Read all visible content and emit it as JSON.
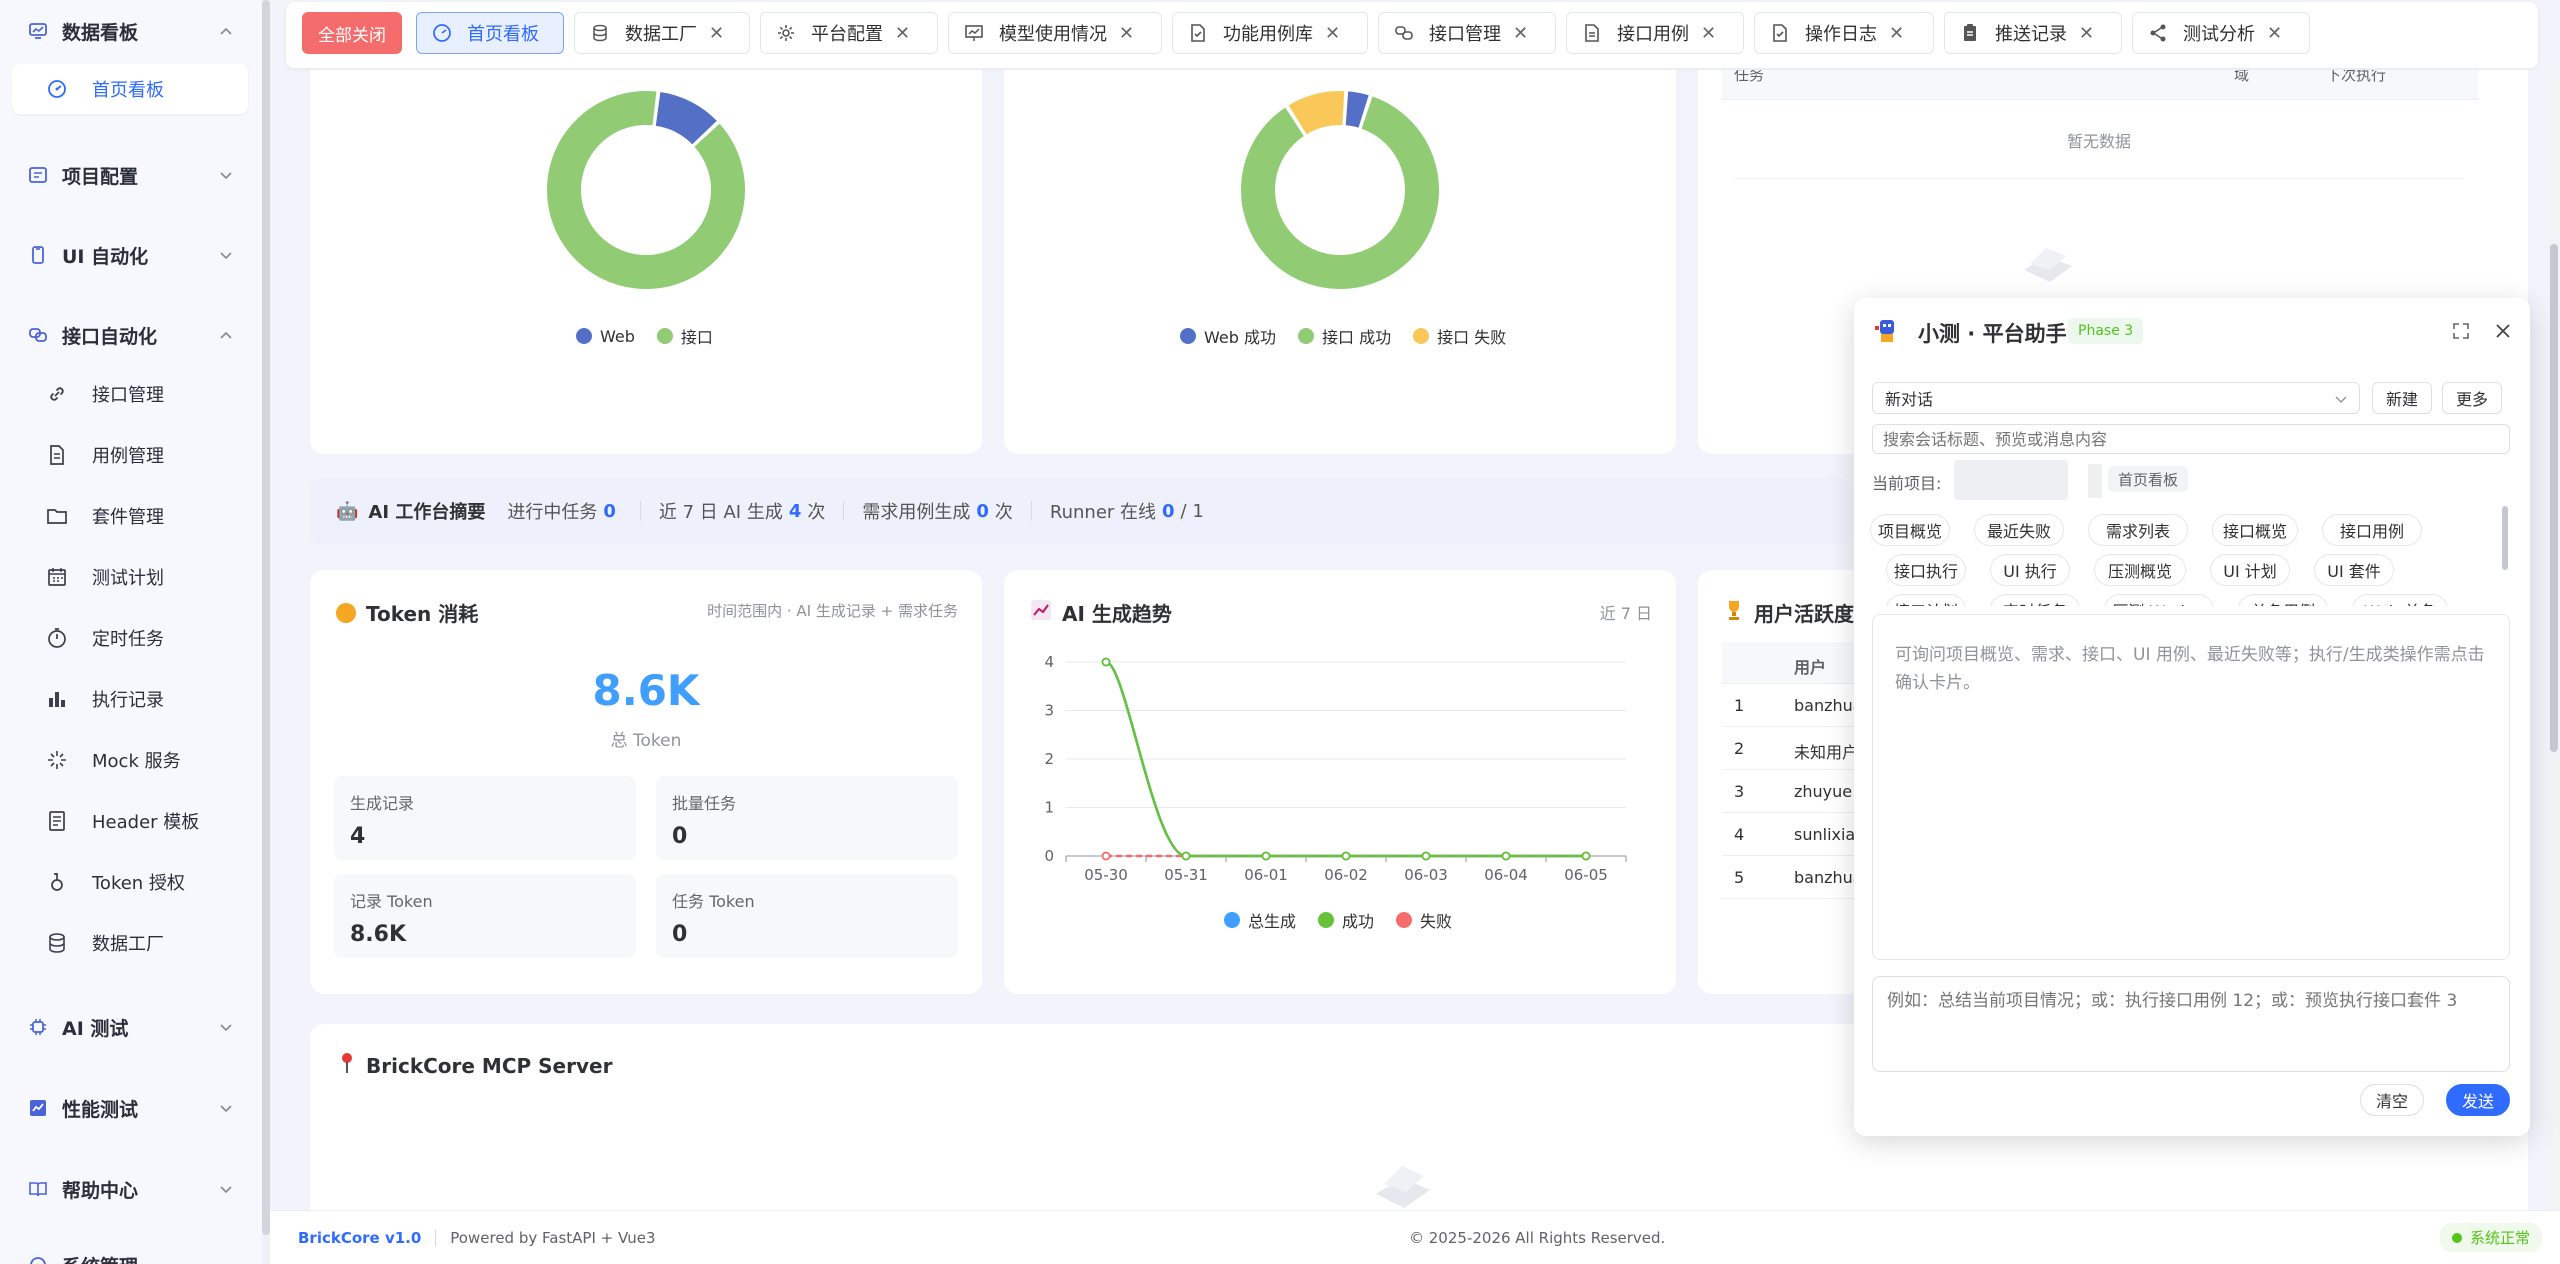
{
  "sidebar": {
    "groups": [
      {
        "label": "数据看板",
        "icon": "dashboard-icon"
      },
      {
        "label": "项目配置",
        "icon": "project-config-icon"
      },
      {
        "label": "UI 自动化",
        "icon": "ui-auto-icon"
      },
      {
        "label": "接口自动化",
        "icon": "api-auto-icon"
      },
      {
        "label": "AI 测试",
        "icon": "ai-test-icon"
      },
      {
        "label": "性能测试",
        "icon": "perf-test-icon"
      },
      {
        "label": "帮助中心",
        "icon": "help-icon"
      },
      {
        "label": "系统管理",
        "icon": "system-icon"
      }
    ],
    "dashboard_items": [
      {
        "label": "首页看板",
        "icon": "dashboard-home-icon"
      }
    ],
    "api_items": [
      {
        "label": "接口管理",
        "icon": "link-icon"
      },
      {
        "label": "用例管理",
        "icon": "document-icon"
      },
      {
        "label": "套件管理",
        "icon": "folder-icon"
      },
      {
        "label": "测试计划",
        "icon": "calendar-icon"
      },
      {
        "label": "定时任务",
        "icon": "timer-icon"
      },
      {
        "label": "执行记录",
        "icon": "bar-chart-icon"
      },
      {
        "label": "Mock 服务",
        "icon": "sparkle-icon"
      },
      {
        "label": "Header 模板",
        "icon": "template-icon"
      },
      {
        "label": "Token 授权",
        "icon": "token-icon"
      },
      {
        "label": "数据工厂",
        "icon": "database-icon"
      }
    ]
  },
  "tabs": {
    "close_all": "全部关闭",
    "items": [
      {
        "label": "首页看板",
        "icon": "dashboard-icon",
        "active": true
      },
      {
        "label": "数据工厂",
        "icon": "database-icon"
      },
      {
        "label": "平台配置",
        "icon": "gear-icon"
      },
      {
        "label": "模型使用情况",
        "icon": "presentation-icon"
      },
      {
        "label": "功能用例库",
        "icon": "document-check-icon"
      },
      {
        "label": "接口管理",
        "icon": "link-icon"
      },
      {
        "label": "接口用例",
        "icon": "document-icon"
      },
      {
        "label": "操作日志",
        "icon": "document-check-icon"
      },
      {
        "label": "推送记录",
        "icon": "clipboard-icon"
      },
      {
        "label": "测试分析",
        "icon": "share-icon"
      }
    ]
  },
  "charts_top": {
    "donut1_legend": [
      "Web",
      "接口"
    ],
    "donut2_legend": [
      "Web 成功",
      "接口 成功",
      "接口 失败"
    ],
    "table_headers": [
      "任务",
      "域",
      "下次执行"
    ],
    "table_empty": "暂无数据"
  },
  "summary": {
    "title": "AI 工作台摘要",
    "running_label": "进行中任务",
    "running_value": "0",
    "ai_gen_label": "近 7 日 AI 生成",
    "ai_gen_value": "4",
    "ai_gen_unit": "次",
    "req_label": "需求用例生成",
    "req_value": "0",
    "req_unit": "次",
    "runner_label": "Runner 在线",
    "runner_value": "0",
    "runner_total": "/ 1"
  },
  "token": {
    "title": "Token 消耗",
    "hint": "时间范围内 · AI 生成记录 + 需求任务",
    "total": "8.6K",
    "total_label": "总 Token",
    "stats": [
      {
        "label": "生成记录",
        "value": "4"
      },
      {
        "label": "批量任务",
        "value": "0"
      },
      {
        "label": "记录 Token",
        "value": "8.6K"
      },
      {
        "label": "任务 Token",
        "value": "0"
      }
    ]
  },
  "trend": {
    "title": "AI 生成趋势",
    "range": "近 7 日"
  },
  "activity": {
    "title": "用户活跃度",
    "header_user": "用户",
    "rows": [
      {
        "rank": "1",
        "user": "banzhua"
      },
      {
        "rank": "2",
        "user": "未知用户"
      },
      {
        "rank": "3",
        "user": "zhuyue"
      },
      {
        "rank": "4",
        "user": "sunlixia"
      },
      {
        "rank": "5",
        "user": "banzhua"
      }
    ]
  },
  "mcp": {
    "title": "BrickCore MCP Server"
  },
  "chat": {
    "title": "小测 · 平台助手",
    "phase": "Phase 3",
    "conversation": "新对话",
    "new_button": "新建",
    "more_button": "更多",
    "search_placeholder": "搜索会话标题、预览或消息内容",
    "current_project_label": "当前项目:",
    "page_tag": "首页看板",
    "chips": [
      "项目概览",
      "最近失败",
      "需求列表",
      "接口概览",
      "接口用例",
      "接口执行",
      "UI 执行",
      "压测概览",
      "UI 计划",
      "UI 套件",
      "接口计划",
      "定时任务",
      "压测 Worker",
      "单条用例",
      "Web 单条"
    ],
    "intro": "可询问项目概览、需求、接口、UI 用例、最近失败等；执行/生成类操作需点击确认卡片。",
    "input_placeholder": "例如：总结当前项目情况；或：执行接口用例 12；或：预览执行接口套件 3",
    "clear_button": "清空",
    "send_button": "发送"
  },
  "footer": {
    "brand": "BrickCore v1.0",
    "powered": "Powered by FastAPI + Vue3",
    "copyright": "© 2025-2026 All Rights Reserved.",
    "status": "系统正常"
  },
  "colors": {
    "web": "#5470c6",
    "api": "#91cc75",
    "fail": "#fac858",
    "primary": "#2f6bff",
    "danger": "#f56c6c",
    "green": "#52c41a"
  },
  "chart_data": [
    {
      "type": "pie",
      "style": "donut",
      "labels": [
        "Web",
        "接口"
      ],
      "values": [
        11,
        89
      ]
    },
    {
      "type": "pie",
      "style": "donut",
      "labels": [
        "Web 成功",
        "接口 成功",
        "接口 失败"
      ],
      "values": [
        4,
        86,
        10
      ]
    },
    {
      "type": "line",
      "title": "AI 生成趋势",
      "categories": [
        "05-30",
        "05-31",
        "06-01",
        "06-02",
        "06-03",
        "06-04",
        "06-05"
      ],
      "series": [
        {
          "name": "总生成",
          "values": [
            4,
            0,
            0,
            0,
            0,
            0,
            0
          ]
        },
        {
          "name": "成功",
          "values": [
            4,
            0,
            0,
            0,
            0,
            0,
            0
          ]
        },
        {
          "name": "失败",
          "values": [
            0,
            0,
            0,
            0,
            0,
            0,
            0
          ]
        }
      ],
      "ylim": [
        0,
        4
      ],
      "yticks": [
        0,
        1,
        2,
        3,
        4
      ],
      "legend": "bottom",
      "grid": true
    }
  ]
}
